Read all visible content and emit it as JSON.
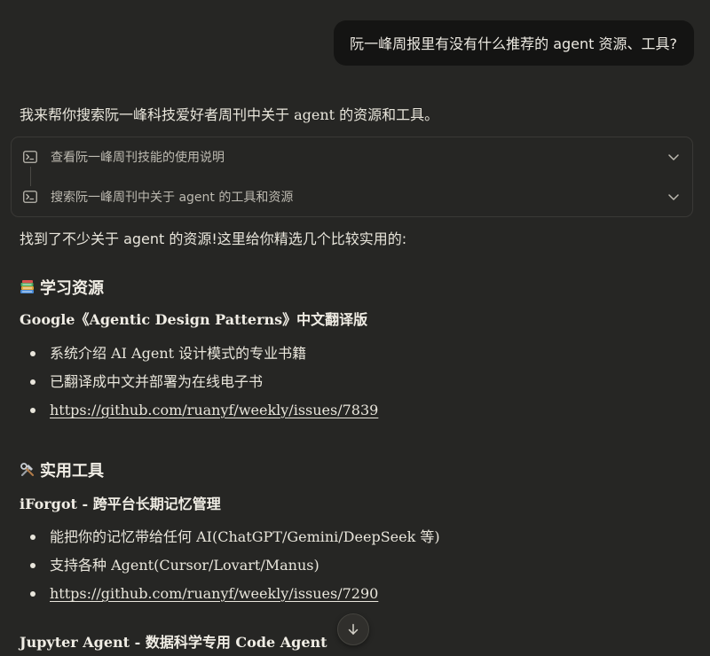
{
  "user_message": "阮一峰周报里有没有什么推荐的 agent 资源、工具?",
  "assistant": {
    "intro": "我来帮你搜索阮一峰科技爱好者周刊中关于 agent 的资源和工具。",
    "tool_calls": [
      {
        "icon": "terminal-icon",
        "label": "查看阮一峰周刊技能的使用说明"
      },
      {
        "icon": "terminal-icon",
        "label": "搜索阮一峰周刊中关于 agent 的工具和资源"
      }
    ],
    "found_text": "找到了不少关于 agent 的资源!这里给你精选几个比较实用的:",
    "sections": [
      {
        "icon": "books-icon",
        "heading": "学习资源",
        "items": [
          {
            "title": "Google《Agentic Design Patterns》中文翻译版",
            "bullets": [
              "系统介绍 AI Agent 设计模式的专业书籍",
              "已翻译成中文并部署为在线电子书"
            ],
            "link": "https://github.com/ruanyf/weekly/issues/7839"
          }
        ]
      },
      {
        "icon": "tools-icon",
        "heading": "实用工具",
        "items": [
          {
            "title": "iForgot - 跨平台长期记忆管理",
            "bullets": [
              "能把你的记忆带给任何 AI(ChatGPT/Gemini/DeepSeek 等)",
              "支持各种 Agent(Cursor/Lovart/Manus)"
            ],
            "link": "https://github.com/ruanyf/weekly/issues/7290"
          },
          {
            "title": "Jupyter Agent - 数据科学专用 Code Agent"
          }
        ]
      }
    ]
  },
  "scroll_button": {
    "icon": "arrow-down-icon"
  }
}
